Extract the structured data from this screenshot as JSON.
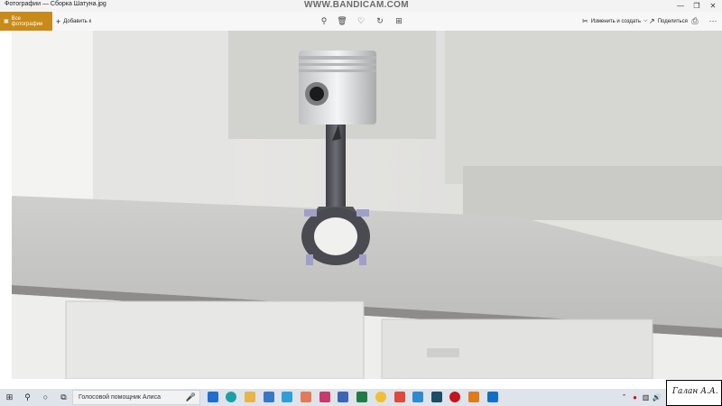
{
  "window": {
    "title": "Фотографии — Сборка Шатуна.jpg",
    "watermark": "WWW.BANDICAM.COM",
    "controls": [
      "minimize",
      "restore",
      "close"
    ]
  },
  "toolbar": {
    "all_photos_label": "Все фотографии",
    "add_to_label": "Добавить к",
    "edit_create_label": "Изменить и создать",
    "share_label": "Поделиться",
    "icons": [
      "zoom-icon",
      "delete-icon",
      "favorite-icon",
      "rotate-icon",
      "crop-icon",
      "print-icon",
      "more-icon"
    ],
    "accent": "#c88a18"
  },
  "image": {
    "subject": "connecting-rod-piston-assembly"
  },
  "taskbar": {
    "search_placeholder": "Голосовой помощник Алиса",
    "apps": [
      "mail",
      "edge",
      "explorer",
      "calculator",
      "paint",
      "photos",
      "excel",
      "yandex",
      "network",
      "terminal",
      "record",
      "word",
      "photos-active"
    ],
    "tray": [
      "chevron-up",
      "record-indicator",
      "network",
      "volume"
    ]
  },
  "signature": {
    "text": "Галан А.А."
  }
}
